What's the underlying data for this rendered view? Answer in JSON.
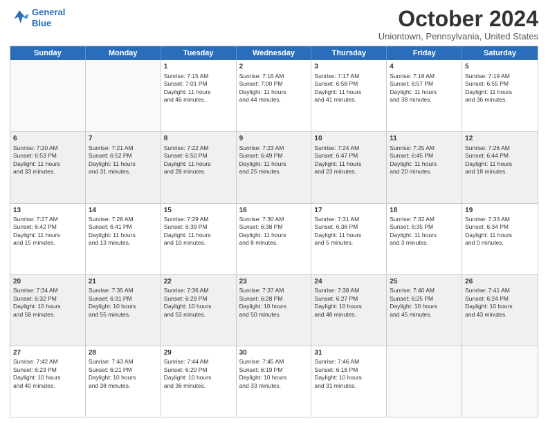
{
  "logo": {
    "line1": "General",
    "line2": "Blue"
  },
  "title": "October 2024",
  "location": "Uniontown, Pennsylvania, United States",
  "header_days": [
    "Sunday",
    "Monday",
    "Tuesday",
    "Wednesday",
    "Thursday",
    "Friday",
    "Saturday"
  ],
  "rows": [
    [
      {
        "day": "",
        "lines": [],
        "empty": true
      },
      {
        "day": "",
        "lines": [],
        "empty": true
      },
      {
        "day": "1",
        "lines": [
          "Sunrise: 7:15 AM",
          "Sunset: 7:01 PM",
          "Daylight: 11 hours",
          "and 46 minutes."
        ]
      },
      {
        "day": "2",
        "lines": [
          "Sunrise: 7:16 AM",
          "Sunset: 7:00 PM",
          "Daylight: 11 hours",
          "and 44 minutes."
        ]
      },
      {
        "day": "3",
        "lines": [
          "Sunrise: 7:17 AM",
          "Sunset: 6:58 PM",
          "Daylight: 11 hours",
          "and 41 minutes."
        ]
      },
      {
        "day": "4",
        "lines": [
          "Sunrise: 7:18 AM",
          "Sunset: 6:57 PM",
          "Daylight: 11 hours",
          "and 38 minutes."
        ]
      },
      {
        "day": "5",
        "lines": [
          "Sunrise: 7:19 AM",
          "Sunset: 6:55 PM",
          "Daylight: 11 hours",
          "and 36 minutes."
        ]
      }
    ],
    [
      {
        "day": "6",
        "lines": [
          "Sunrise: 7:20 AM",
          "Sunset: 6:53 PM",
          "Daylight: 11 hours",
          "and 33 minutes."
        ]
      },
      {
        "day": "7",
        "lines": [
          "Sunrise: 7:21 AM",
          "Sunset: 6:52 PM",
          "Daylight: 11 hours",
          "and 31 minutes."
        ]
      },
      {
        "day": "8",
        "lines": [
          "Sunrise: 7:22 AM",
          "Sunset: 6:50 PM",
          "Daylight: 11 hours",
          "and 28 minutes."
        ]
      },
      {
        "day": "9",
        "lines": [
          "Sunrise: 7:23 AM",
          "Sunset: 6:49 PM",
          "Daylight: 11 hours",
          "and 25 minutes."
        ]
      },
      {
        "day": "10",
        "lines": [
          "Sunrise: 7:24 AM",
          "Sunset: 6:47 PM",
          "Daylight: 11 hours",
          "and 23 minutes."
        ]
      },
      {
        "day": "11",
        "lines": [
          "Sunrise: 7:25 AM",
          "Sunset: 6:45 PM",
          "Daylight: 11 hours",
          "and 20 minutes."
        ]
      },
      {
        "day": "12",
        "lines": [
          "Sunrise: 7:26 AM",
          "Sunset: 6:44 PM",
          "Daylight: 11 hours",
          "and 18 minutes."
        ]
      }
    ],
    [
      {
        "day": "13",
        "lines": [
          "Sunrise: 7:27 AM",
          "Sunset: 6:42 PM",
          "Daylight: 11 hours",
          "and 15 minutes."
        ]
      },
      {
        "day": "14",
        "lines": [
          "Sunrise: 7:28 AM",
          "Sunset: 6:41 PM",
          "Daylight: 11 hours",
          "and 13 minutes."
        ]
      },
      {
        "day": "15",
        "lines": [
          "Sunrise: 7:29 AM",
          "Sunset: 6:39 PM",
          "Daylight: 11 hours",
          "and 10 minutes."
        ]
      },
      {
        "day": "16",
        "lines": [
          "Sunrise: 7:30 AM",
          "Sunset: 6:38 PM",
          "Daylight: 11 hours",
          "and 8 minutes."
        ]
      },
      {
        "day": "17",
        "lines": [
          "Sunrise: 7:31 AM",
          "Sunset: 6:36 PM",
          "Daylight: 11 hours",
          "and 5 minutes."
        ]
      },
      {
        "day": "18",
        "lines": [
          "Sunrise: 7:32 AM",
          "Sunset: 6:35 PM",
          "Daylight: 11 hours",
          "and 3 minutes."
        ]
      },
      {
        "day": "19",
        "lines": [
          "Sunrise: 7:33 AM",
          "Sunset: 6:34 PM",
          "Daylight: 11 hours",
          "and 0 minutes."
        ]
      }
    ],
    [
      {
        "day": "20",
        "lines": [
          "Sunrise: 7:34 AM",
          "Sunset: 6:32 PM",
          "Daylight: 10 hours",
          "and 58 minutes."
        ]
      },
      {
        "day": "21",
        "lines": [
          "Sunrise: 7:35 AM",
          "Sunset: 6:31 PM",
          "Daylight: 10 hours",
          "and 55 minutes."
        ]
      },
      {
        "day": "22",
        "lines": [
          "Sunrise: 7:36 AM",
          "Sunset: 6:29 PM",
          "Daylight: 10 hours",
          "and 53 minutes."
        ]
      },
      {
        "day": "23",
        "lines": [
          "Sunrise: 7:37 AM",
          "Sunset: 6:28 PM",
          "Daylight: 10 hours",
          "and 50 minutes."
        ]
      },
      {
        "day": "24",
        "lines": [
          "Sunrise: 7:38 AM",
          "Sunset: 6:27 PM",
          "Daylight: 10 hours",
          "and 48 minutes."
        ]
      },
      {
        "day": "25",
        "lines": [
          "Sunrise: 7:40 AM",
          "Sunset: 6:25 PM",
          "Daylight: 10 hours",
          "and 45 minutes."
        ]
      },
      {
        "day": "26",
        "lines": [
          "Sunrise: 7:41 AM",
          "Sunset: 6:24 PM",
          "Daylight: 10 hours",
          "and 43 minutes."
        ]
      }
    ],
    [
      {
        "day": "27",
        "lines": [
          "Sunrise: 7:42 AM",
          "Sunset: 6:23 PM",
          "Daylight: 10 hours",
          "and 40 minutes."
        ]
      },
      {
        "day": "28",
        "lines": [
          "Sunrise: 7:43 AM",
          "Sunset: 6:21 PM",
          "Daylight: 10 hours",
          "and 38 minutes."
        ]
      },
      {
        "day": "29",
        "lines": [
          "Sunrise: 7:44 AM",
          "Sunset: 6:20 PM",
          "Daylight: 10 hours",
          "and 36 minutes."
        ]
      },
      {
        "day": "30",
        "lines": [
          "Sunrise: 7:45 AM",
          "Sunset: 6:19 PM",
          "Daylight: 10 hours",
          "and 33 minutes."
        ]
      },
      {
        "day": "31",
        "lines": [
          "Sunrise: 7:46 AM",
          "Sunset: 6:18 PM",
          "Daylight: 10 hours",
          "and 31 minutes."
        ]
      },
      {
        "day": "",
        "lines": [],
        "empty": true
      },
      {
        "day": "",
        "lines": [],
        "empty": true
      }
    ]
  ]
}
